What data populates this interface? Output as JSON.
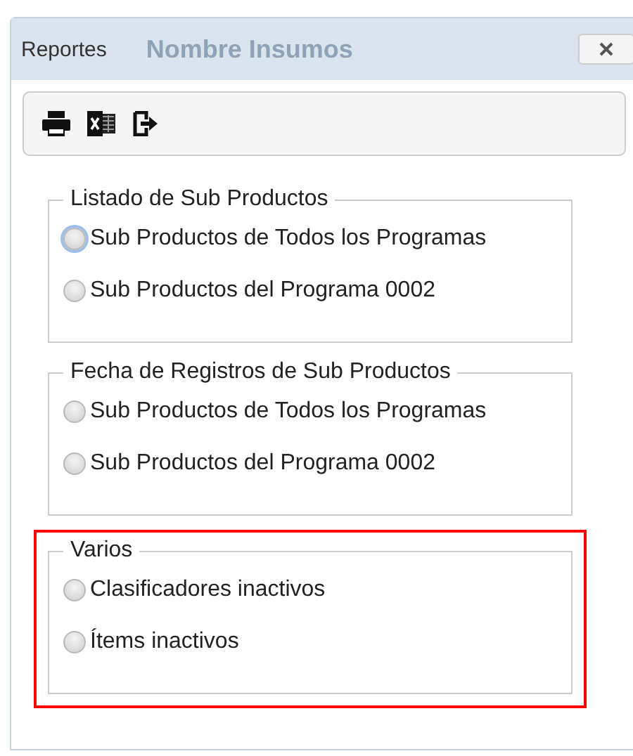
{
  "window": {
    "title": "Reportes",
    "background_text": "Nombre Insumos"
  },
  "toolbar": [
    {
      "kind": "print"
    },
    {
      "kind": "excel"
    },
    {
      "kind": "exit"
    }
  ],
  "groups": [
    {
      "legend": "Listado de Sub Productos",
      "highlighted": false,
      "options": [
        {
          "label": "Sub Productos de Todos los Programas",
          "selected": false,
          "focused": true
        },
        {
          "label": "Sub Productos del Programa 0002",
          "selected": false,
          "focused": false
        }
      ]
    },
    {
      "legend": "Fecha de Registros de Sub Productos",
      "highlighted": false,
      "options": [
        {
          "label": "Sub Productos de Todos los Programas",
          "selected": false,
          "focused": false
        },
        {
          "label": "Sub Productos del Programa 0002",
          "selected": false,
          "focused": false
        }
      ]
    },
    {
      "legend": "Varios",
      "highlighted": true,
      "options": [
        {
          "label": "Clasificadores inactivos",
          "selected": false,
          "focused": false
        },
        {
          "label": "Ítems inactivos",
          "selected": false,
          "focused": false
        }
      ]
    }
  ]
}
